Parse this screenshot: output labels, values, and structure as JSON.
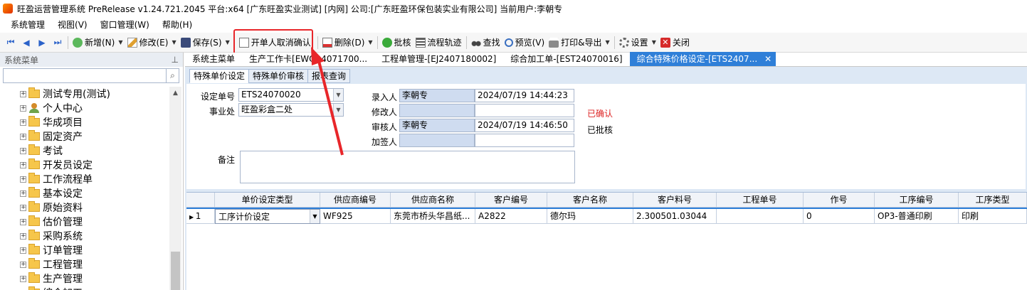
{
  "window": {
    "title": "旺盈运营管理系统 PreRelease v1.24.721.2045 平台:x64  [广东旺盈实业测试] [内网] 公司:[广东旺盈环保包装实业有限公司] 当前用户:李朝专"
  },
  "menu": [
    "系统管理",
    "视图(V)",
    "窗口管理(W)",
    "帮助(H)"
  ],
  "toolbar": {
    "new_label": "新增(N)",
    "edit_label": "修改(E)",
    "save_label": "保存(S)",
    "cancel_confirm_label": "开单人取消确认",
    "delete_label": "删除(D)",
    "approve_label": "批核",
    "flow_label": "流程轨迹",
    "find_label": "查找",
    "preview_label": "预览(V)",
    "print_label": "打印&导出",
    "settings_label": "设置",
    "close_label": "关闭"
  },
  "sidebar": {
    "title": "系统菜单",
    "pin": "ᵖ",
    "search_placeholder": "",
    "items": [
      {
        "label": "测试专用(测试)",
        "icon": "folder-icon"
      },
      {
        "label": "个人中心",
        "icon": "person-icon"
      },
      {
        "label": "华成项目",
        "icon": "folder-icon"
      },
      {
        "label": "固定资产",
        "icon": "folder-icon"
      },
      {
        "label": "考试",
        "icon": "folder-icon"
      },
      {
        "label": "开发员设定",
        "icon": "folder-icon"
      },
      {
        "label": "工作流程单",
        "icon": "folder-icon"
      },
      {
        "label": "基本设定",
        "icon": "folder-icon"
      },
      {
        "label": "原始资料",
        "icon": "folder-icon"
      },
      {
        "label": "估价管理",
        "icon": "folder-icon"
      },
      {
        "label": "采购系统",
        "icon": "folder-icon"
      },
      {
        "label": "订单管理",
        "icon": "folder-icon"
      },
      {
        "label": "工程管理",
        "icon": "folder-icon"
      },
      {
        "label": "生产管理",
        "icon": "folder-icon"
      },
      {
        "label": "综合加工",
        "icon": "folder-icon"
      }
    ]
  },
  "doc_tabs": [
    {
      "label": "系统主菜单"
    },
    {
      "label": "生产工作卡[EWO24071700..."
    },
    {
      "label": "工程单管理-[EJ2407180002]"
    },
    {
      "label": "综合加工单-[EST24070016]"
    },
    {
      "label": "综合特殊价格设定-[ETS2407...",
      "active": true
    }
  ],
  "sub_tabs": [
    {
      "label": "特殊单价设定",
      "active": true
    },
    {
      "label": "特殊单价审核"
    },
    {
      "label": "报表查询"
    }
  ],
  "form": {
    "code_label": "设定单号",
    "code_value": "ETS24070020",
    "dept_label": "事业处",
    "dept_value": "旺盈彩盒二处",
    "entry_label": "录入人",
    "entry_value": "李朝专",
    "entry_time": "2024/07/19 14:44:23",
    "modify_label": "修改人",
    "modify_value": "",
    "modify_time": "",
    "audit_label": "审核人",
    "audit_value": "李朝专",
    "audit_time": "2024/07/19 14:46:50",
    "sign_label": "加签人",
    "sign_value": "",
    "sign_time": "",
    "remark_label": "备注",
    "remark_value": "",
    "status_confirmed": "已确认",
    "status_approved": "已批核"
  },
  "grid": {
    "headers": [
      "",
      "单价设定类型",
      "供应商编号",
      "供应商名称",
      "客户编号",
      "客户名称",
      "客户料号",
      "工程单号",
      "作号",
      "工序编号",
      "工序类型"
    ],
    "rows": [
      [
        "1",
        "工序计价设定",
        "WF925",
        "东莞市桥头华昌纸...",
        "A2822",
        "德尔玛",
        "2.300501.03044",
        "",
        "0",
        "OP3-普通印刷",
        "印刷"
      ]
    ]
  },
  "colors": {
    "accent": "#2f7fd8",
    "highlight_red": "#e8262a",
    "status_confirmed": "#dd2222"
  }
}
